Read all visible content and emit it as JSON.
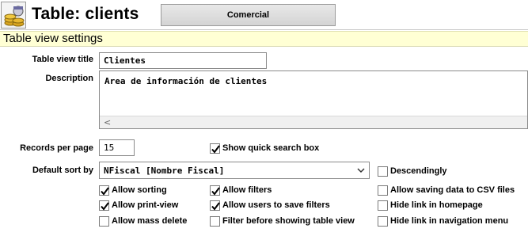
{
  "header": {
    "title": "Table: clients",
    "group_button": "Comercial",
    "icon": "coins-stack-icon"
  },
  "section": {
    "title": "Table view settings"
  },
  "form": {
    "view_title_label": "Table view title",
    "view_title_value": "Clientes",
    "description_label": "Description",
    "description_value": "Area de información de clientes",
    "records_label": "Records per page",
    "records_value": "15",
    "show_search_label": "Show quick search box",
    "default_sort_label": "Default sort by",
    "default_sort_value": "NFiscal [Nombre Fiscal]",
    "descending_label": "Descendingly"
  },
  "options": {
    "allow_sorting": {
      "label": "Allow sorting",
      "checked": true
    },
    "allow_filters": {
      "label": "Allow filters",
      "checked": true
    },
    "allow_csv": {
      "label": "Allow saving data to CSV files",
      "checked": false
    },
    "allow_print": {
      "label": "Allow print-view",
      "checked": true
    },
    "allow_save_filters": {
      "label": "Allow users to save filters",
      "checked": true
    },
    "hide_homepage": {
      "label": "Hide link in homepage",
      "checked": false
    },
    "allow_mass_delete": {
      "label": "Allow mass delete",
      "checked": false
    },
    "filter_before": {
      "label": "Filter before showing table view",
      "checked": false
    },
    "hide_nav": {
      "label": "Hide link in navigation menu",
      "checked": false
    },
    "show_search": {
      "checked": true
    },
    "descending": {
      "checked": false
    }
  },
  "colors": {
    "section_bg": "#ffffd4",
    "button_bg": "#d8d8d8"
  }
}
